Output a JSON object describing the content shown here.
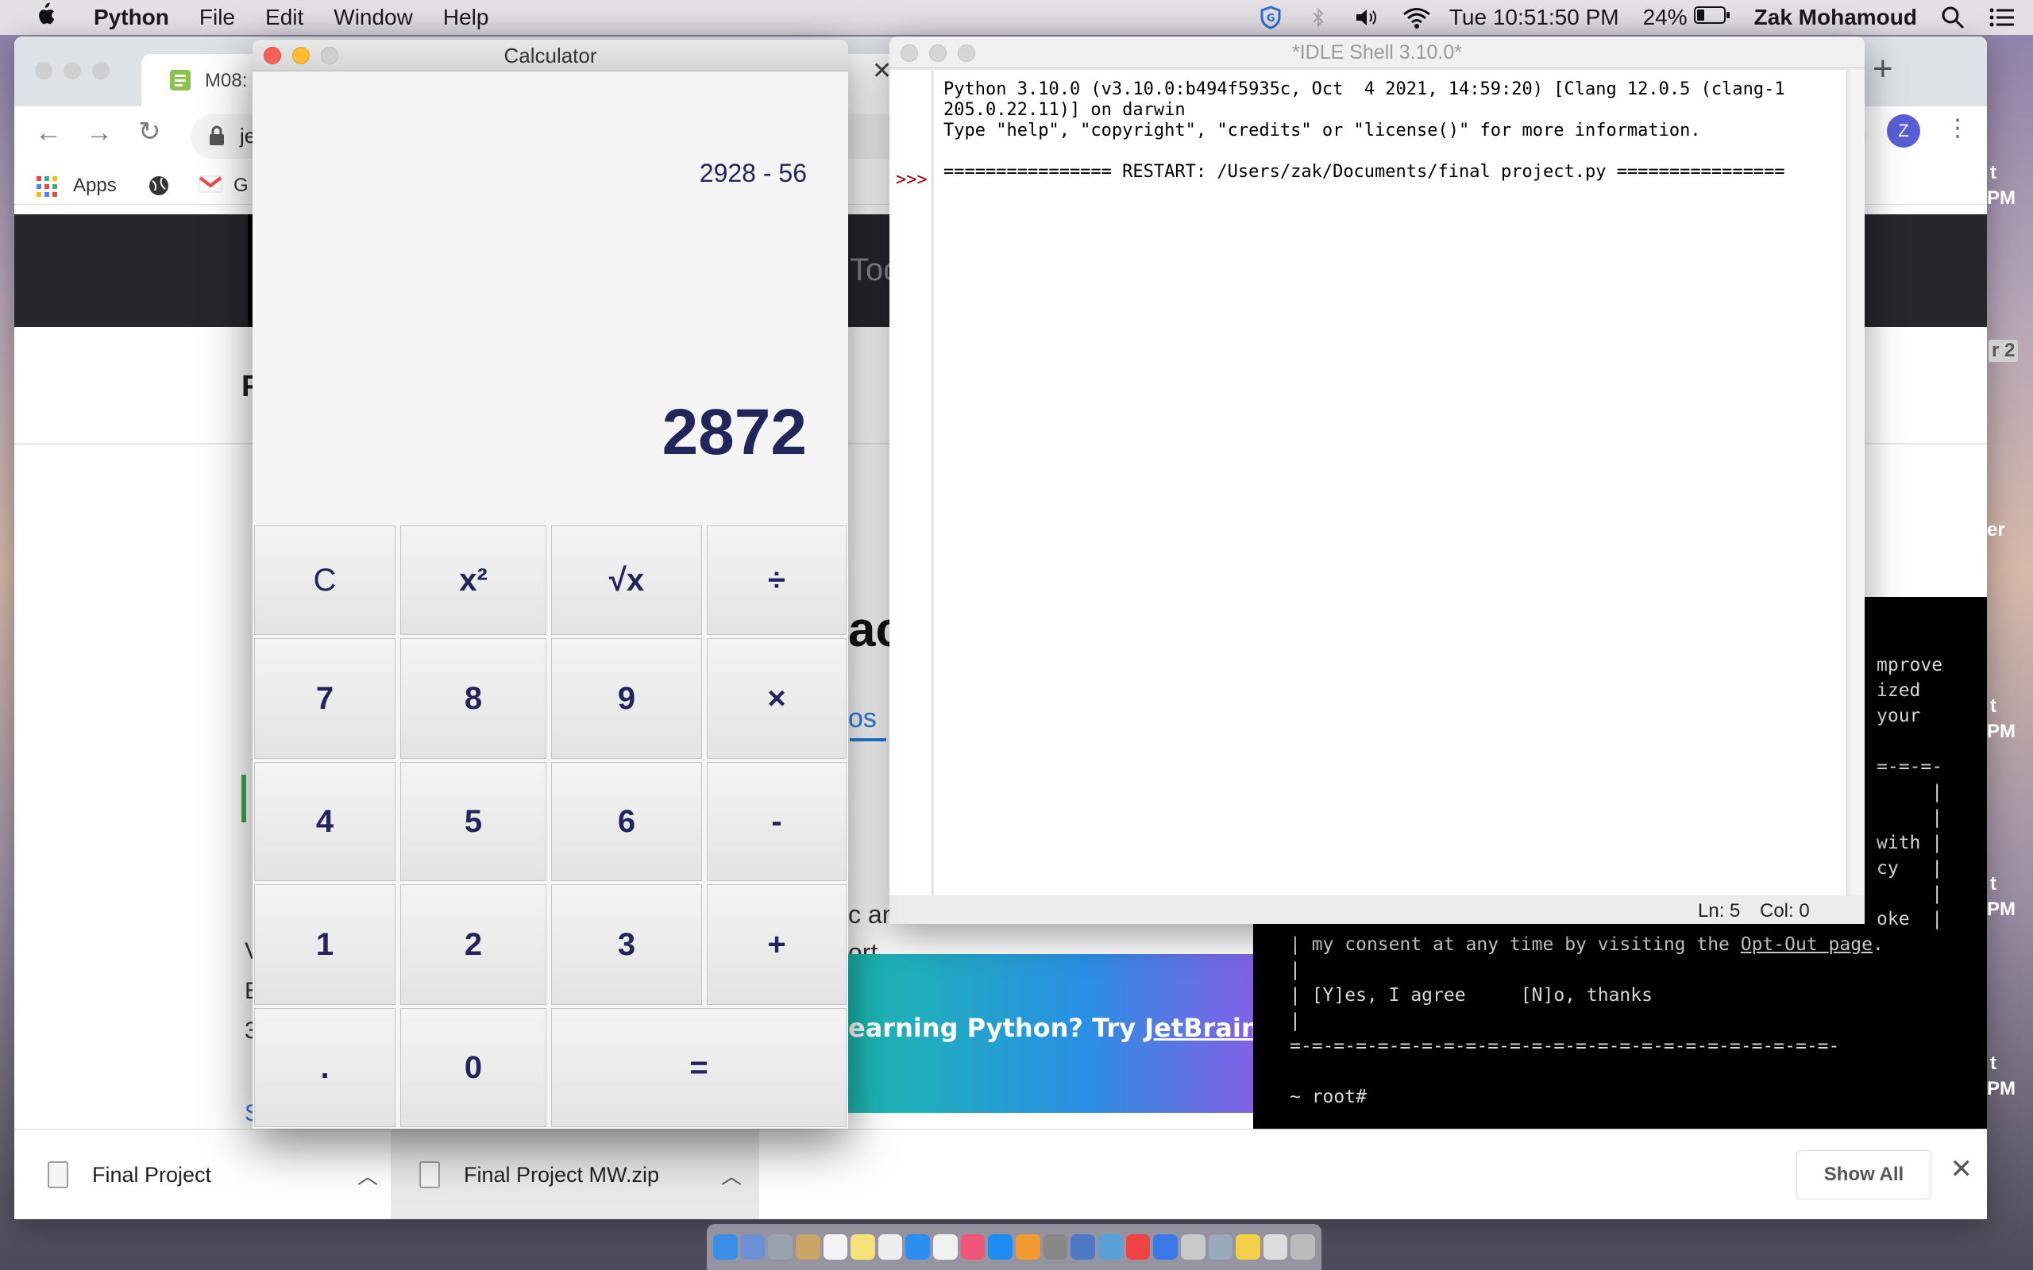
{
  "menubar": {
    "app_name": "Python",
    "items": [
      "File",
      "Edit",
      "Window",
      "Help"
    ],
    "clock": "Tue 10:51:50 PM",
    "battery": "24%",
    "user": "Zak Mohamoud"
  },
  "browser": {
    "tab_title": "M08: F",
    "address_partial": "je",
    "bookmarks": [
      "Apps",
      "G"
    ],
    "page_fragments": {
      "dark_header_text": "Too",
      "section_heading_partial": "ac",
      "link_partial": "os",
      "body_line_1": "c an",
      "body_line_2": "ort.",
      "left_f": "F",
      "left_v": "V",
      "left_e": "E",
      "left_3": "3",
      "left_s": "S"
    },
    "ad": {
      "prefix": "earning Python? Try ",
      "link": "JetBrains"
    },
    "terminal": {
      "lines": [
        "mprove",
        "ized",
        "your",
        "",
        "=-=-=-",
        "     |",
        "     |",
        "with |",
        "cy   |",
        "     |",
        "oke  |"
      ],
      "consent_line": "my consent at any time by visiting the ",
      "consent_link": "Opt-Out page",
      "choice_line": "| [Y]es, I agree     [N]o, thanks",
      "rule_line": "=-=-=-=-=-=-=-=-=-=-=-=-=-=-=-=-=-=-=-=-=-=-=-=-=-",
      "prompt": "~ root#"
    },
    "downloads": [
      {
        "name": "Final Project"
      },
      {
        "name": "Final Project MW.zip"
      }
    ],
    "show_all": "Show All",
    "side_fragments": [
      "t",
      "PM",
      "r 2",
      "er",
      "t",
      "PM",
      "t",
      "PM",
      "t",
      "PM"
    ],
    "avatar_letter": "Z"
  },
  "calculator": {
    "title": "Calculator",
    "expression": "2928 - 56",
    "result": "2872",
    "keys": {
      "clear": "C",
      "square": "x²",
      "sqrt": "√x",
      "divide": "÷",
      "seven": "7",
      "eight": "8",
      "nine": "9",
      "multiply": "×",
      "four": "4",
      "five": "5",
      "six": "6",
      "minus": "-",
      "one": "1",
      "two": "2",
      "three": "3",
      "plus": "+",
      "dot": ".",
      "zero": "0",
      "equals": "="
    }
  },
  "idle": {
    "title": "*IDLE Shell 3.10.0*",
    "lines": [
      "Python 3.10.0 (v3.10.0:b494f5935c, Oct  4 2021, 14:59:20) [Clang 12.0.5 (clang-1",
      "205.0.22.11)] on darwin",
      "Type \"help\", \"copyright\", \"credits\" or \"license()\" for more information.",
      "",
      "================ RESTART: /Users/zak/Documents/final project.py ================"
    ],
    "prompt": ">>>",
    "status_ln": "Ln: 5",
    "status_col": "Col: 0"
  }
}
